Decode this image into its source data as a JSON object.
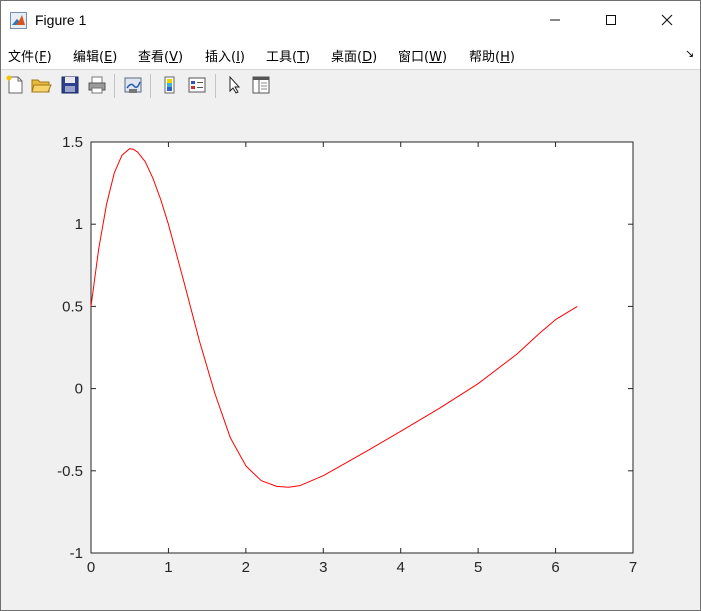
{
  "window": {
    "title": "Figure 1",
    "minimize_glyph": "—",
    "maximize_glyph": "☐",
    "close_glyph": "✕"
  },
  "menu": {
    "items": [
      {
        "label": "文件(",
        "key": "F",
        "suffix": ")"
      },
      {
        "label": "编辑(",
        "key": "E",
        "suffix": ")"
      },
      {
        "label": "查看(",
        "key": "V",
        "suffix": ")"
      },
      {
        "label": "插入(",
        "key": "I",
        "suffix": ")"
      },
      {
        "label": "工具(",
        "key": "T",
        "suffix": ")"
      },
      {
        "label": "桌面(",
        "key": "D",
        "suffix": ")"
      },
      {
        "label": "窗口(",
        "key": "W",
        "suffix": ")"
      },
      {
        "label": "帮助(",
        "key": "H",
        "suffix": ")"
      }
    ],
    "overflow_glyph": "↘"
  },
  "toolbar": {
    "icons": [
      "new-figure-icon",
      "open-file-icon",
      "save-icon",
      "print-icon",
      "link-plot-icon",
      "colorbar-icon",
      "legend-icon",
      "pointer-icon",
      "property-inspector-icon"
    ]
  },
  "chart_data": {
    "type": "line",
    "title": "",
    "xlabel": "",
    "ylabel": "",
    "xlim": [
      0,
      7
    ],
    "ylim": [
      -1,
      1.5
    ],
    "xticks": [
      "0",
      "1",
      "2",
      "3",
      "4",
      "5",
      "6",
      "7"
    ],
    "yticks": [
      "-1",
      "-0.5",
      "0",
      "0.5",
      "1",
      "1.5"
    ],
    "grid": false,
    "series": [
      {
        "color": "#ff0000",
        "x": [
          0,
          0.1,
          0.2,
          0.3,
          0.4,
          0.5,
          0.55,
          0.6,
          0.7,
          0.8,
          0.9,
          1.0,
          1.2,
          1.4,
          1.6,
          1.8,
          2.0,
          2.2,
          2.4,
          2.55,
          2.7,
          3.0,
          3.3,
          3.6,
          4.0,
          4.5,
          5.0,
          5.5,
          5.8,
          6.0,
          6.28
        ],
        "values": [
          0.5,
          0.85,
          1.12,
          1.31,
          1.42,
          1.46,
          1.455,
          1.44,
          1.38,
          1.28,
          1.15,
          1.0,
          0.65,
          0.29,
          -0.03,
          -0.3,
          -0.47,
          -0.56,
          -0.595,
          -0.6,
          -0.59,
          -0.53,
          -0.45,
          -0.37,
          -0.26,
          -0.12,
          0.03,
          0.21,
          0.34,
          0.42,
          0.5
        ]
      }
    ]
  }
}
